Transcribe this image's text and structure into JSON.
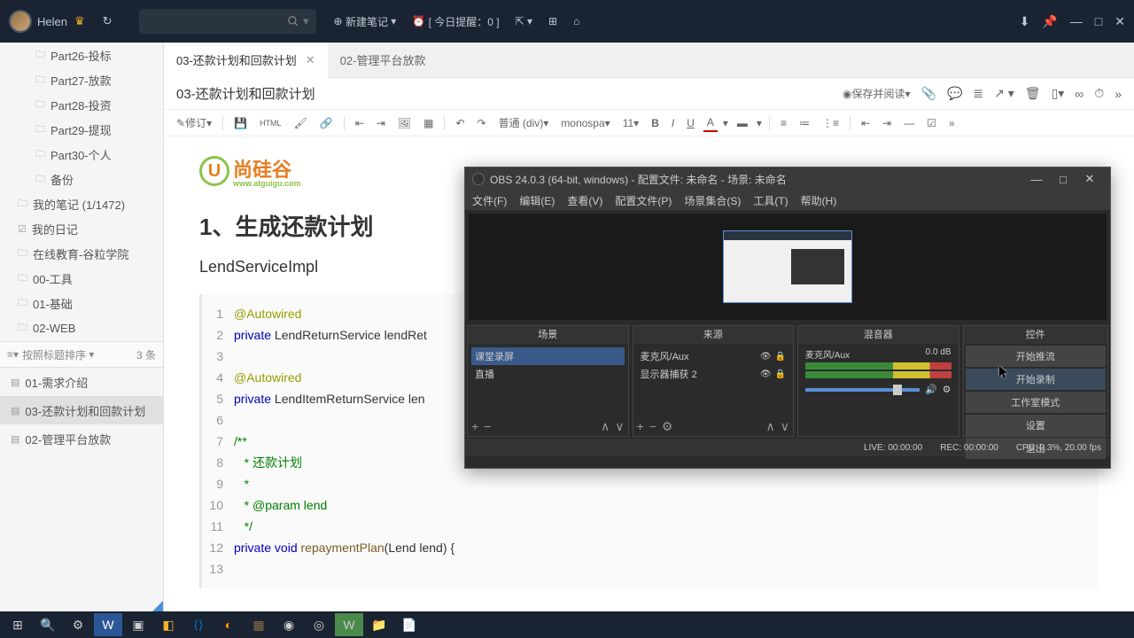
{
  "titlebar": {
    "username": "Helen",
    "new_note": "新建笔记",
    "reminder": "[ 今日提醒：0 ]"
  },
  "sidebar": {
    "folders": [
      "Part26-投标",
      "Part27-放款",
      "Part28-投资",
      "Part29-提现",
      "Part30-个人",
      "备份"
    ],
    "special": [
      {
        "label": "我的笔记 (1/1472)",
        "icon": "folder"
      },
      {
        "label": "我的日记",
        "icon": "check"
      },
      {
        "label": "在线教育-谷粒学院",
        "icon": "folder"
      },
      {
        "label": "00-工具",
        "icon": "folder"
      },
      {
        "label": "01-基础",
        "icon": "folder"
      },
      {
        "label": "02-WEB",
        "icon": "folder"
      }
    ],
    "sort_label": "按照标题排序",
    "count_label": "3 条",
    "notes": [
      {
        "label": "01-需求介绍",
        "active": false
      },
      {
        "label": "03-还款计划和回款计划",
        "active": true
      },
      {
        "label": "02-管理平台放款",
        "active": false
      }
    ]
  },
  "tabs": [
    {
      "label": "03-还款计划和回款计划",
      "active": true
    },
    {
      "label": "02-管理平台放款",
      "active": false
    }
  ],
  "editor_header": {
    "title": "03-还款计划和回款计划",
    "view_mode": "保存并阅读"
  },
  "toolbar": {
    "edit": "修订",
    "html": "HTML",
    "format_sel": "普通 (div)",
    "font_sel": "monospa",
    "size_sel": "11"
  },
  "document": {
    "logo_text": "尚硅谷",
    "logo_sub": "www.atguigu.com",
    "h1": "1、生成还款计划",
    "classname": "LendServiceImpl",
    "code": [
      {
        "n": "1",
        "html": "<span class='anno'>@Autowired</span>"
      },
      {
        "n": "2",
        "html": "<span class='kw'>private</span> LendReturnService lendRet"
      },
      {
        "n": "3",
        "html": ""
      },
      {
        "n": "4",
        "html": "<span class='anno'>@Autowired</span>"
      },
      {
        "n": "5",
        "html": "<span class='kw'>private</span> LendItemReturnService len"
      },
      {
        "n": "6",
        "html": ""
      },
      {
        "n": "7",
        "html": "<span class='str'>/**</span>"
      },
      {
        "n": "8",
        "html": "<span class='str'>&nbsp;&nbsp;&nbsp;* 还款计划</span>"
      },
      {
        "n": "9",
        "html": "<span class='str'>&nbsp;&nbsp;&nbsp;*</span>"
      },
      {
        "n": "10",
        "html": "<span class='str'>&nbsp;&nbsp;&nbsp;* @param lend</span>"
      },
      {
        "n": "11",
        "html": "<span class='str'>&nbsp;&nbsp;&nbsp;*/</span>"
      },
      {
        "n": "12",
        "html": "<span class='kw'>private</span> <span class='kw'>void</span> <span class='fn'>repaymentPlan</span>(Lend lend) {"
      },
      {
        "n": "13",
        "html": ""
      }
    ]
  },
  "obs": {
    "title": "OBS 24.0.3 (64-bit, windows) - 配置文件: 未命名 - 场景: 未命名",
    "menu": [
      "文件(F)",
      "编辑(E)",
      "查看(V)",
      "配置文件(P)",
      "场景集合(S)",
      "工具(T)",
      "帮助(H)"
    ],
    "panel_scenes": "场景",
    "panel_sources": "来源",
    "panel_mixer": "混音器",
    "panel_controls": "控件",
    "scenes": [
      {
        "label": "课堂录屏",
        "sel": true
      },
      {
        "label": "直播",
        "sel": false
      }
    ],
    "sources": [
      {
        "label": "麦克风/Aux",
        "count": ""
      },
      {
        "label": "显示器捕获",
        "count": "2"
      }
    ],
    "mixer_label": "麦克风/Aux",
    "mixer_db": "0.0 dB",
    "controls": [
      {
        "label": "开始推流",
        "hl": false
      },
      {
        "label": "开始录制",
        "hl": true
      },
      {
        "label": "工作室模式",
        "hl": false
      },
      {
        "label": "设置",
        "hl": false
      },
      {
        "label": "退出",
        "hl": false
      }
    ],
    "status_live": "LIVE: 00:00:00",
    "status_rec": "REC: 00:00:00",
    "status_cpu": "CPU: 0.3%, 20.00 fps"
  }
}
